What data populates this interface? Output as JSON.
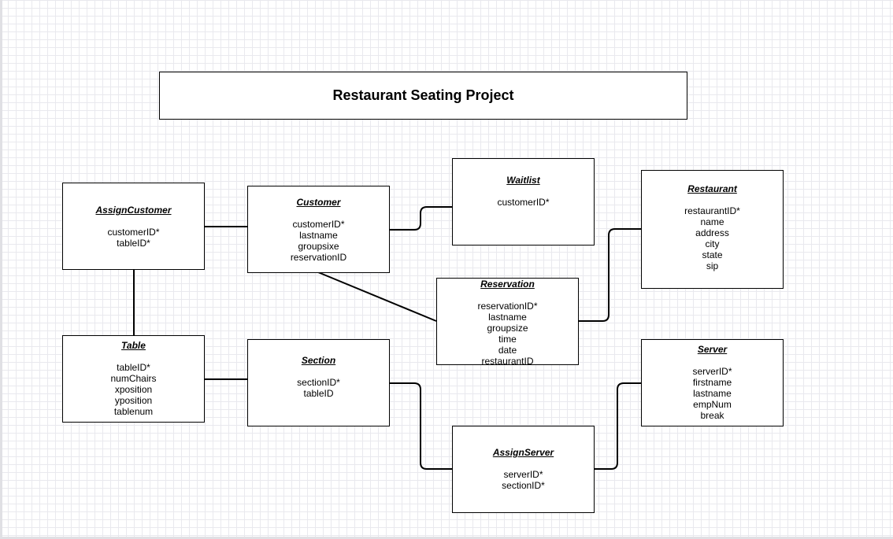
{
  "title": "Restaurant Seating Project",
  "entities": {
    "assign_customer": {
      "name": "AssignCustomer",
      "attributes": [
        "customerID*",
        "tableID*"
      ]
    },
    "customer": {
      "name": "Customer",
      "attributes": [
        "customerID*",
        "lastname",
        "groupsixe",
        "reservationID"
      ]
    },
    "waitlist": {
      "name": "Waitlist",
      "attributes": [
        "customerID*"
      ]
    },
    "restaurant": {
      "name": "Restaurant",
      "attributes": [
        "restaurantID*",
        "name",
        "address",
        "city",
        "state",
        "sip"
      ]
    },
    "reservation": {
      "name": "Reservation",
      "attributes": [
        "reservationID*",
        "lastname",
        "groupsize",
        "time",
        "date",
        "restaurantID"
      ]
    },
    "table": {
      "name": "Table",
      "attributes": [
        "tableID*",
        "numChairs",
        "xposition",
        "yposition",
        "tablenum"
      ]
    },
    "section": {
      "name": "Section",
      "attributes": [
        "sectionID*",
        "tableID"
      ]
    },
    "server": {
      "name": "Server",
      "attributes": [
        "serverID*",
        "firstname",
        "lastname",
        "empNum",
        "break"
      ]
    },
    "assign_server": {
      "name": "AssignServer",
      "attributes": [
        "serverID*",
        "sectionID*"
      ]
    }
  }
}
